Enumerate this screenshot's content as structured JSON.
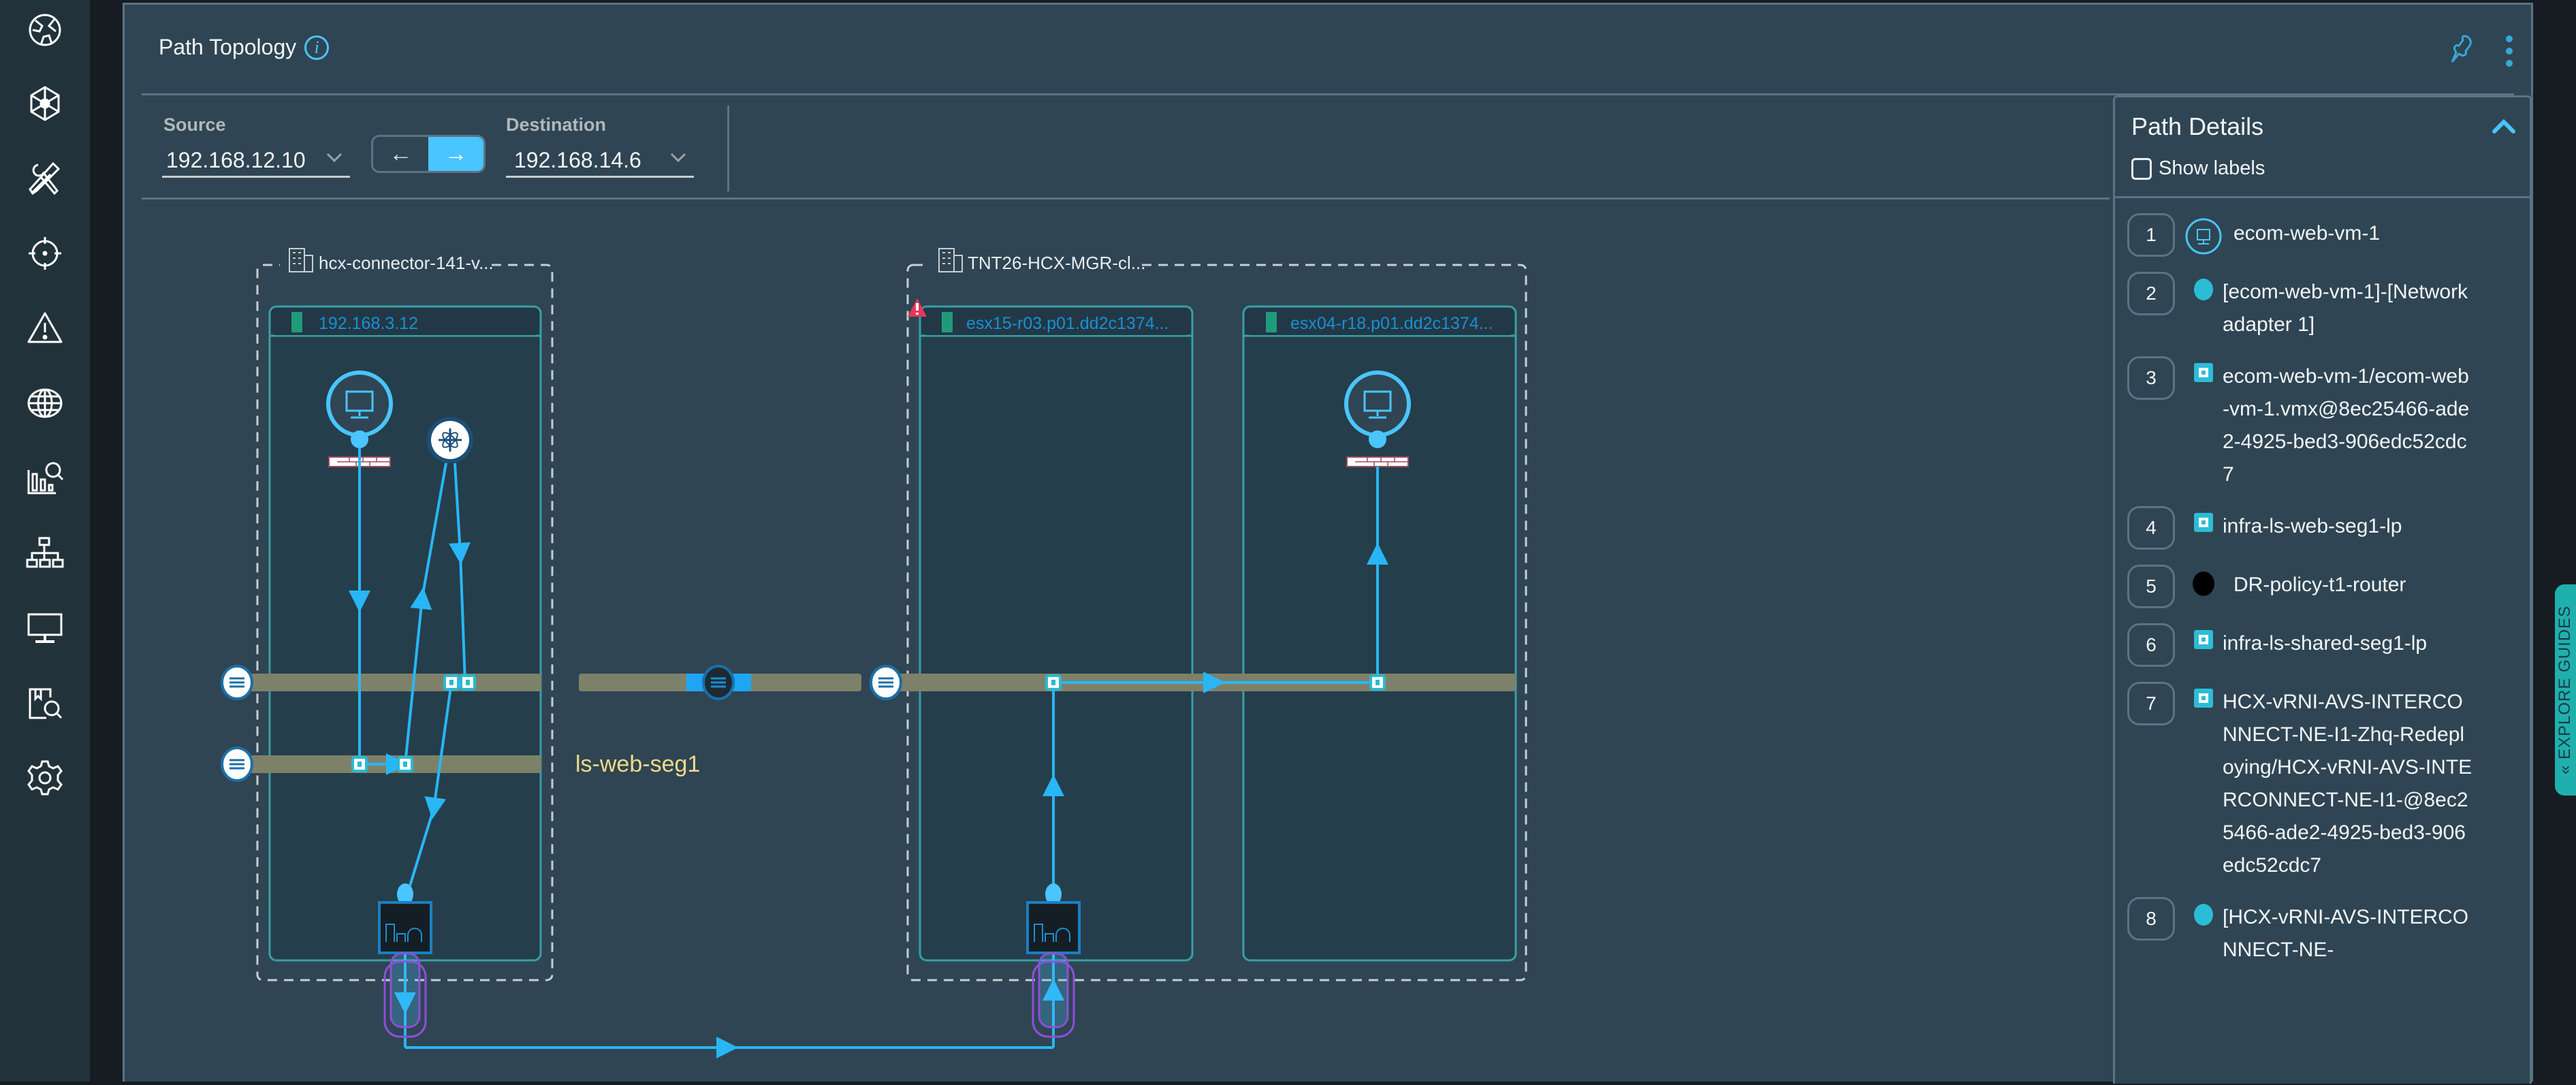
{
  "sidebar": {
    "items": [
      {
        "icon": "globe-segments-icon",
        "name": "home"
      },
      {
        "icon": "network-mesh-icon",
        "name": "network-insights"
      },
      {
        "icon": "tools-icon",
        "name": "troubleshoot"
      },
      {
        "icon": "crosshair-icon",
        "name": "discover"
      },
      {
        "icon": "alert-icon",
        "name": "alerts"
      },
      {
        "icon": "globe-icon",
        "name": "network"
      },
      {
        "icon": "chart-search-icon",
        "name": "analytics"
      },
      {
        "icon": "hierarchy-icon",
        "name": "topology"
      },
      {
        "icon": "monitor-icon",
        "name": "vm"
      },
      {
        "icon": "library-search-icon",
        "name": "search"
      },
      {
        "icon": "gear-icon",
        "name": "settings"
      }
    ]
  },
  "header": {
    "title": "Path Topology",
    "info_glyph": "i"
  },
  "controls": {
    "source_label": "Source",
    "source_value": "192.168.12.10",
    "destination_label": "Destination",
    "destination_value": "192.168.14.6",
    "direction_left": "←",
    "direction_right": "→",
    "active_direction": "right"
  },
  "topology": {
    "sites": [
      {
        "name": "hcx-connector-141-v...",
        "hosts": [
          {
            "name": "192.168.3.12"
          }
        ]
      },
      {
        "name": "TNT26-HCX-MGR-cl...",
        "hosts": [
          {
            "name": "esx15-r03.p01.dd2c1374...",
            "warning": true
          },
          {
            "name": "esx04-r18.p01.dd2c1374..."
          }
        ]
      }
    ],
    "segment_label": "ls-web-seg1"
  },
  "path_details": {
    "title": "Path Details",
    "show_labels": "Show labels",
    "show_labels_checked": false,
    "steps": [
      {
        "num": "1",
        "icon": "vm",
        "text": "ecom-web-vm-1"
      },
      {
        "num": "2",
        "icon": "nic",
        "text": "[ecom-web-vm-1]-[Network adapter 1]"
      },
      {
        "num": "3",
        "icon": "port",
        "text": "ecom-web-vm-1/ecom-web-vm-1.vmx@8ec25466-ade2-4925-bed3-906edc52cdc7"
      },
      {
        "num": "4",
        "icon": "port",
        "text": "infra-ls-web-seg1-lp"
      },
      {
        "num": "5",
        "icon": "router",
        "text": "DR-policy-t1-router"
      },
      {
        "num": "6",
        "icon": "port",
        "text": "infra-ls-shared-seg1-lp"
      },
      {
        "num": "7",
        "icon": "port",
        "text": "HCX-vRNI-AVS-INTERCONNECT-NE-I1-Zhq-Redeploying/HCX-vRNI-AVS-INTERCONNECT-NE-I1-@8ec25466-ade2-4925-bed3-906edc52cdc7"
      },
      {
        "num": "8",
        "icon": "nic",
        "text": "[HCX-vRNI-AVS-INTERCONNECT-NE-"
      }
    ]
  },
  "explore_guides": "EXPLORE GUIDES",
  "colors": {
    "accent": "#49c5ff",
    "segment": "#7e8169",
    "host_border": "#3a9ea5",
    "warning": "#e8365d",
    "tunnel": "#8e4fd9"
  }
}
